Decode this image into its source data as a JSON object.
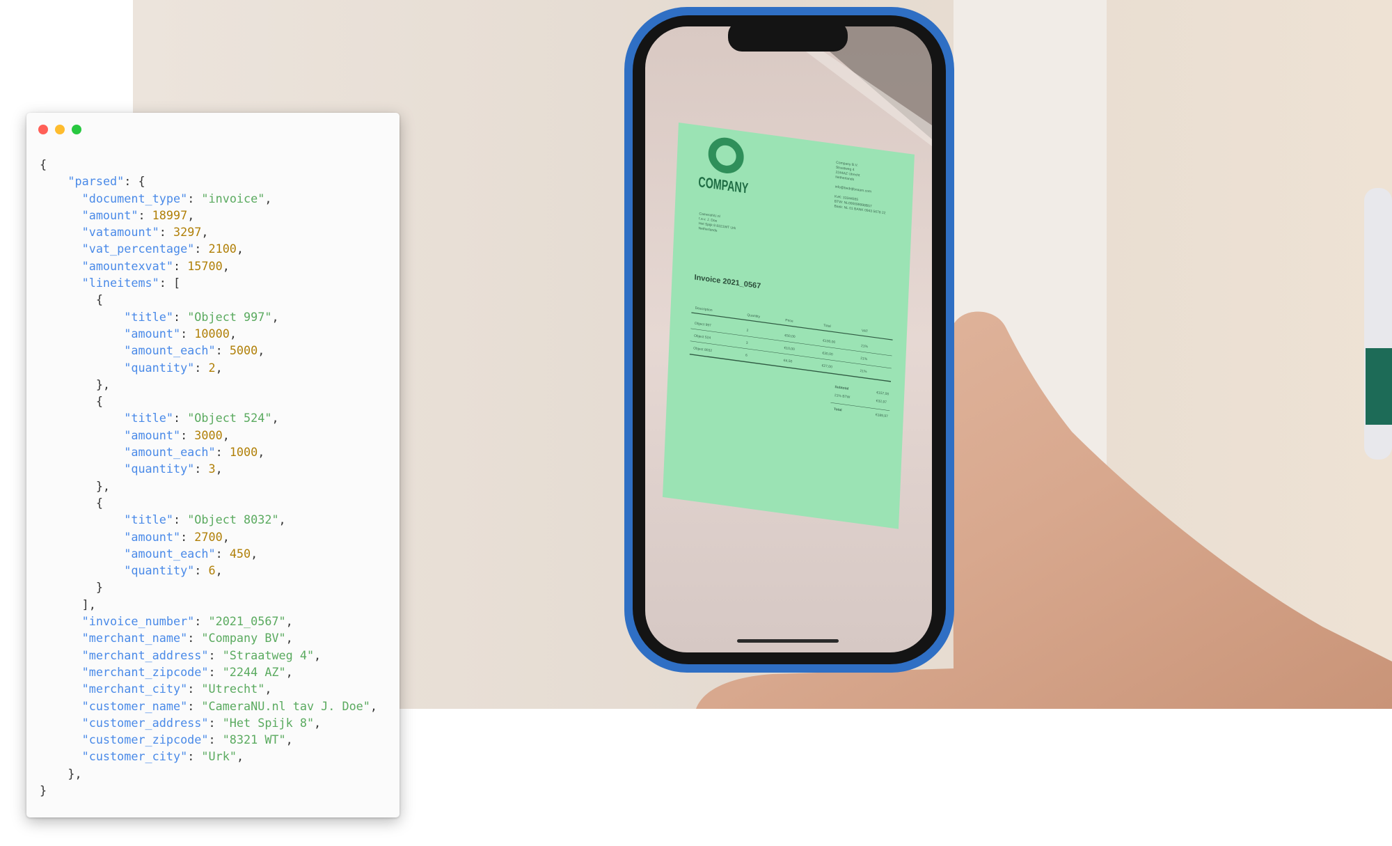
{
  "window": {
    "controls": [
      {
        "name": "close",
        "color": "#ff5f57"
      },
      {
        "name": "minimize",
        "color": "#febc2e"
      },
      {
        "name": "maximize",
        "color": "#28c840"
      }
    ]
  },
  "colors": {
    "key": "#4a8ae8",
    "string": "#5aaa5f",
    "number": "#b07f07",
    "punct": "#333333",
    "phone_frame": "#2f6fc4",
    "overlay": "#9be3b4"
  },
  "code": {
    "lines": [
      [
        [
          "punct",
          "{"
        ]
      ],
      [
        [
          "punct",
          "    "
        ],
        [
          "key",
          "\"parsed\""
        ],
        [
          "punct",
          ": {"
        ]
      ],
      [
        [
          "punct",
          "      "
        ],
        [
          "key",
          "\"document_type\""
        ],
        [
          "punct",
          ": "
        ],
        [
          "str",
          "\"invoice\""
        ],
        [
          "punct",
          ","
        ]
      ],
      [
        [
          "punct",
          "      "
        ],
        [
          "key",
          "\"amount\""
        ],
        [
          "punct",
          ": "
        ],
        [
          "num",
          "18997"
        ],
        [
          "punct",
          ","
        ]
      ],
      [
        [
          "punct",
          "      "
        ],
        [
          "key",
          "\"vatamount\""
        ],
        [
          "punct",
          ": "
        ],
        [
          "num",
          "3297"
        ],
        [
          "punct",
          ","
        ]
      ],
      [
        [
          "punct",
          "      "
        ],
        [
          "key",
          "\"vat_percentage\""
        ],
        [
          "punct",
          ": "
        ],
        [
          "num",
          "2100"
        ],
        [
          "punct",
          ","
        ]
      ],
      [
        [
          "punct",
          "      "
        ],
        [
          "key",
          "\"amountexvat\""
        ],
        [
          "punct",
          ": "
        ],
        [
          "num",
          "15700"
        ],
        [
          "punct",
          ","
        ]
      ],
      [
        [
          "punct",
          "      "
        ],
        [
          "key",
          "\"lineitems\""
        ],
        [
          "punct",
          ": ["
        ]
      ],
      [
        [
          "punct",
          "        {"
        ]
      ],
      [
        [
          "punct",
          "            "
        ],
        [
          "key",
          "\"title\""
        ],
        [
          "punct",
          ": "
        ],
        [
          "str",
          "\"Object 997\""
        ],
        [
          "punct",
          ","
        ]
      ],
      [
        [
          "punct",
          "            "
        ],
        [
          "key",
          "\"amount\""
        ],
        [
          "punct",
          ": "
        ],
        [
          "num",
          "10000"
        ],
        [
          "punct",
          ","
        ]
      ],
      [
        [
          "punct",
          "            "
        ],
        [
          "key",
          "\"amount_each\""
        ],
        [
          "punct",
          ": "
        ],
        [
          "num",
          "5000"
        ],
        [
          "punct",
          ","
        ]
      ],
      [
        [
          "punct",
          "            "
        ],
        [
          "key",
          "\"quantity\""
        ],
        [
          "punct",
          ": "
        ],
        [
          "num",
          "2"
        ],
        [
          "punct",
          ","
        ]
      ],
      [
        [
          "punct",
          "        },"
        ]
      ],
      [
        [
          "punct",
          "        {"
        ]
      ],
      [
        [
          "punct",
          "            "
        ],
        [
          "key",
          "\"title\""
        ],
        [
          "punct",
          ": "
        ],
        [
          "str",
          "\"Object 524\""
        ],
        [
          "punct",
          ","
        ]
      ],
      [
        [
          "punct",
          "            "
        ],
        [
          "key",
          "\"amount\""
        ],
        [
          "punct",
          ": "
        ],
        [
          "num",
          "3000"
        ],
        [
          "punct",
          ","
        ]
      ],
      [
        [
          "punct",
          "            "
        ],
        [
          "key",
          "\"amount_each\""
        ],
        [
          "punct",
          ": "
        ],
        [
          "num",
          "1000"
        ],
        [
          "punct",
          ","
        ]
      ],
      [
        [
          "punct",
          "            "
        ],
        [
          "key",
          "\"quantity\""
        ],
        [
          "punct",
          ": "
        ],
        [
          "num",
          "3"
        ],
        [
          "punct",
          ","
        ]
      ],
      [
        [
          "punct",
          "        },"
        ]
      ],
      [
        [
          "punct",
          "        {"
        ]
      ],
      [
        [
          "punct",
          "            "
        ],
        [
          "key",
          "\"title\""
        ],
        [
          "punct",
          ": "
        ],
        [
          "str",
          "\"Object 8032\""
        ],
        [
          "punct",
          ","
        ]
      ],
      [
        [
          "punct",
          "            "
        ],
        [
          "key",
          "\"amount\""
        ],
        [
          "punct",
          ": "
        ],
        [
          "num",
          "2700"
        ],
        [
          "punct",
          ","
        ]
      ],
      [
        [
          "punct",
          "            "
        ],
        [
          "key",
          "\"amount_each\""
        ],
        [
          "punct",
          ": "
        ],
        [
          "num",
          "450"
        ],
        [
          "punct",
          ","
        ]
      ],
      [
        [
          "punct",
          "            "
        ],
        [
          "key",
          "\"quantity\""
        ],
        [
          "punct",
          ": "
        ],
        [
          "num",
          "6"
        ],
        [
          "punct",
          ","
        ]
      ],
      [
        [
          "punct",
          "        }"
        ]
      ],
      [
        [
          "punct",
          "      ],"
        ]
      ],
      [
        [
          "punct",
          "      "
        ],
        [
          "key",
          "\"invoice_number\""
        ],
        [
          "punct",
          ": "
        ],
        [
          "str",
          "\"2021_0567\""
        ],
        [
          "punct",
          ","
        ]
      ],
      [
        [
          "punct",
          "      "
        ],
        [
          "key",
          "\"merchant_name\""
        ],
        [
          "punct",
          ": "
        ],
        [
          "str",
          "\"Company BV\""
        ],
        [
          "punct",
          ","
        ]
      ],
      [
        [
          "punct",
          "      "
        ],
        [
          "key",
          "\"merchant_address\""
        ],
        [
          "punct",
          ": "
        ],
        [
          "str",
          "\"Straatweg 4\""
        ],
        [
          "punct",
          ","
        ]
      ],
      [
        [
          "punct",
          "      "
        ],
        [
          "key",
          "\"merchant_zipcode\""
        ],
        [
          "punct",
          ": "
        ],
        [
          "str",
          "\"2244 AZ\""
        ],
        [
          "punct",
          ","
        ]
      ],
      [
        [
          "punct",
          "      "
        ],
        [
          "key",
          "\"merchant_city\""
        ],
        [
          "punct",
          ": "
        ],
        [
          "str",
          "\"Utrecht\""
        ],
        [
          "punct",
          ","
        ]
      ],
      [
        [
          "punct",
          "      "
        ],
        [
          "key",
          "\"customer_name\""
        ],
        [
          "punct",
          ": "
        ],
        [
          "str",
          "\"CameraNU.nl tav J. Doe\""
        ],
        [
          "punct",
          ","
        ]
      ],
      [
        [
          "punct",
          "      "
        ],
        [
          "key",
          "\"customer_address\""
        ],
        [
          "punct",
          ": "
        ],
        [
          "str",
          "\"Het Spijk 8\""
        ],
        [
          "punct",
          ","
        ]
      ],
      [
        [
          "punct",
          "      "
        ],
        [
          "key",
          "\"customer_zipcode\""
        ],
        [
          "punct",
          ": "
        ],
        [
          "str",
          "\"8321 WT\""
        ],
        [
          "punct",
          ","
        ]
      ],
      [
        [
          "punct",
          "      "
        ],
        [
          "key",
          "\"customer_city\""
        ],
        [
          "punct",
          ": "
        ],
        [
          "str",
          "\"Urk\""
        ],
        [
          "punct",
          ","
        ]
      ],
      [
        [
          "punct",
          "    },"
        ]
      ],
      [
        [
          "punct",
          "}"
        ]
      ]
    ]
  },
  "invoice": {
    "logo_text": "COMPANY",
    "merchant_block": [
      "Company B.V.",
      "Straatweg 4",
      "2244AZ Utrecht",
      "Netherlands",
      "",
      "info@bedrijfsnaam.com",
      "",
      "KvK: 33344555",
      "BTW: NL000099998B57",
      "Bank: NL 01 BANK 0943 5678 22"
    ],
    "customer_block": [
      "CameraNU.nl",
      "t.a.v. J. Doe",
      "Het Spijk 8 8321WT Urk",
      "Netherlands"
    ],
    "title": "Invoice 2021_0567",
    "table": {
      "headers": [
        "Description",
        "Quantity",
        "Price",
        "Total",
        "VAT"
      ],
      "rows": [
        [
          "Object 997",
          "2",
          "€50,00",
          "€100,00",
          "21%"
        ],
        [
          "Object 524",
          "3",
          "€10,00",
          "€30,00",
          "21%"
        ],
        [
          "Object 8032",
          "6",
          "€4,50",
          "€27,00",
          "21%"
        ]
      ]
    },
    "totals": [
      {
        "label": "Subtotal",
        "value": "€157,00"
      },
      {
        "label": "21% BTW",
        "value": "€32,97"
      },
      {
        "label": "Total",
        "value": "€189,97"
      }
    ]
  }
}
